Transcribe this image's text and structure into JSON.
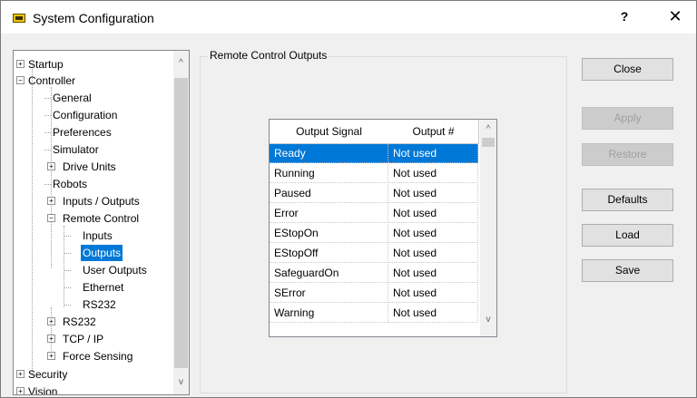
{
  "window": {
    "title": "System Configuration",
    "help": "?",
    "close": "✕"
  },
  "tree": {
    "items": [
      {
        "label": "Startup"
      },
      {
        "label": "Controller"
      },
      {
        "label": "General"
      },
      {
        "label": "Configuration"
      },
      {
        "label": "Preferences"
      },
      {
        "label": "Simulator"
      },
      {
        "label": "Drive Units"
      },
      {
        "label": "Robots"
      },
      {
        "label": "Inputs / Outputs"
      },
      {
        "label": "Remote Control"
      },
      {
        "label": "Inputs"
      },
      {
        "label": "Outputs"
      },
      {
        "label": "User Outputs"
      },
      {
        "label": "Ethernet"
      },
      {
        "label": "RS232"
      },
      {
        "label": "RS232"
      },
      {
        "label": "TCP / IP"
      },
      {
        "label": "Force Sensing"
      },
      {
        "label": "Security"
      },
      {
        "label": "Vision"
      }
    ],
    "expander_plus": "+",
    "expander_minus": "−",
    "scroll_up": "^",
    "scroll_down": "v"
  },
  "group": {
    "title": "Remote Control Outputs"
  },
  "grid": {
    "columns": [
      "Output Signal",
      "Output #"
    ],
    "rows": [
      [
        "Ready",
        "Not used"
      ],
      [
        "Running",
        "Not used"
      ],
      [
        "Paused",
        "Not used"
      ],
      [
        "Error",
        "Not used"
      ],
      [
        "EStopOn",
        "Not used"
      ],
      [
        "EStopOff",
        "Not used"
      ],
      [
        "SafeguardOn",
        "Not used"
      ],
      [
        "SError",
        "Not used"
      ],
      [
        "Warning",
        "Not used"
      ]
    ],
    "scroll_up": "^",
    "scroll_down": "v"
  },
  "buttons": {
    "close": "Close",
    "apply": "Apply",
    "restore": "Restore",
    "defaults": "Defaults",
    "load": "Load",
    "save": "Save"
  }
}
